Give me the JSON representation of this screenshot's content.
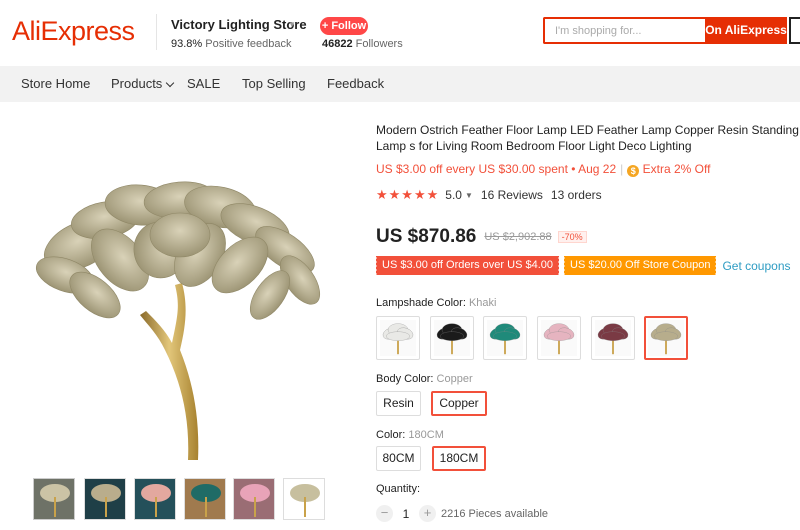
{
  "header": {
    "logo": "AliExpress",
    "store_name": "Victory Lighting Store",
    "feedback_value": "93.8%",
    "feedback_label": "Positive feedback",
    "follow_label": "+ Follow",
    "followers_value": "46822",
    "followers_label": "Followers",
    "search_placeholder": "I'm shopping for...",
    "search_button": "On AliExpress"
  },
  "nav": {
    "items": [
      {
        "label": "Store Home"
      },
      {
        "label": "Products"
      },
      {
        "label": "SALE"
      },
      {
        "label": "Top Selling"
      },
      {
        "label": "Feedback"
      }
    ]
  },
  "product": {
    "title": "Modern Ostrich Feather Floor Lamp LED Feather Lamp Copper Resin Standing Lamp s for Living Room Bedroom Floor Light Deco Lighting",
    "promo_text": "US $3.00 off every US $30.00 spent • Aug 22",
    "extra_off": "Extra 2% Off",
    "rating": "5.0",
    "reviews": "16 Reviews",
    "orders": "13 orders",
    "price": "US $870.86",
    "old_price": "US $2,902.88",
    "discount": "-70%",
    "coupon_1": "US $3.00 off Orders over US $4.00",
    "coupon_2": "US $20.00 Off Store Coupon",
    "get_coupons": "Get coupons"
  },
  "options": {
    "lampshade_label": "Lampshade Color:",
    "lampshade_value": "Khaki",
    "lampshade_swatches": [
      {
        "color": "#e9e9e6",
        "bg": "#fafafa"
      },
      {
        "color": "#1b1b1b",
        "bg": "#fafafa"
      },
      {
        "color": "#1f8a7a",
        "bg": "#fafafa"
      },
      {
        "color": "#e6b4c0",
        "bg": "#fafafa"
      },
      {
        "color": "#7a3a44",
        "bg": "#fafafa"
      },
      {
        "color": "#b7ad8c",
        "bg": "#fafafa"
      }
    ],
    "body_label": "Body Color:",
    "body_value": "Copper",
    "body_options": [
      "Resin",
      "Copper"
    ],
    "size_label": "Color:",
    "size_value": "180CM",
    "size_options": [
      "80CM",
      "180CM"
    ],
    "quantity_label": "Quantity:",
    "quantity_value": "1",
    "quantity_available": "2216 Pieces available"
  },
  "colors": {
    "brand": "#e62e04",
    "accent": "#f2503a",
    "coupon_orange": "#ff9800",
    "link": "#2e9cc3"
  }
}
